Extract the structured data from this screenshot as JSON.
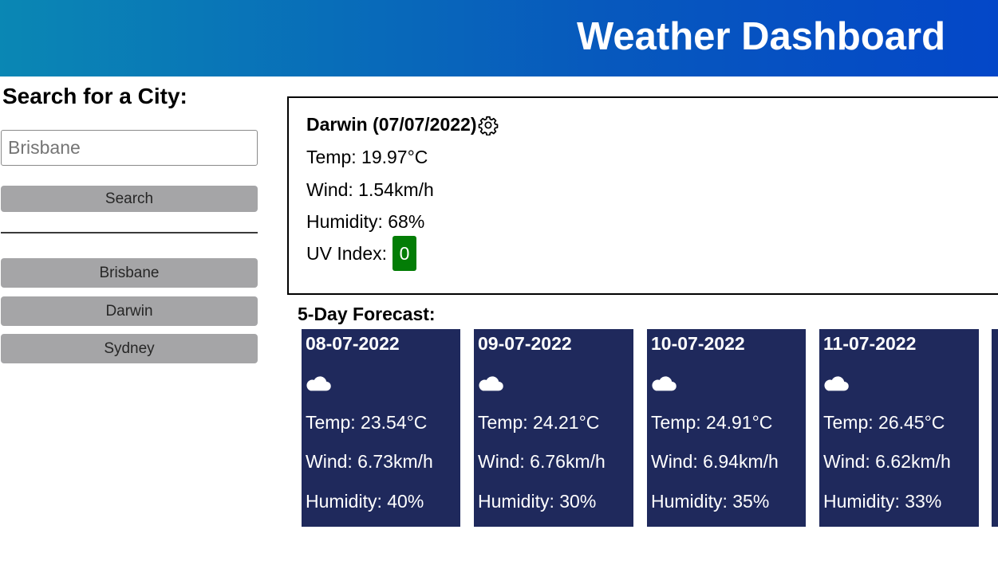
{
  "header": {
    "title": "Weather Dashboard"
  },
  "sidebar": {
    "heading": "Search for a City:",
    "search_placeholder": "Brisbane",
    "search_button": "Search",
    "history": [
      "Brisbane",
      "Darwin",
      "Sydney"
    ]
  },
  "current": {
    "title": "Darwin (07/07/2022)",
    "icon": "gear-icon",
    "temp": "Temp: 19.97°C",
    "wind": "Wind: 1.54km/h",
    "humidity": "Humidity: 68%",
    "uv_label": "UV Index:",
    "uv_value": "0",
    "uv_color": "#037d06"
  },
  "forecast": {
    "title": "5-Day Forecast:",
    "days": [
      {
        "date": "08-07-2022",
        "icon": "cloud-icon",
        "temp": "Temp: 23.54°C",
        "wind": "Wind: 6.73km/h",
        "humidity": "Humidity: 40%"
      },
      {
        "date": "09-07-2022",
        "icon": "cloud-icon",
        "temp": "Temp: 24.21°C",
        "wind": "Wind: 6.76km/h",
        "humidity": "Humidity: 30%"
      },
      {
        "date": "10-07-2022",
        "icon": "cloud-icon",
        "temp": "Temp: 24.91°C",
        "wind": "Wind: 6.94km/h",
        "humidity": "Humidity: 35%"
      },
      {
        "date": "11-07-2022",
        "icon": "cloud-icon",
        "temp": "Temp: 26.45°C",
        "wind": "Wind: 6.62km/h",
        "humidity": "Humidity: 33%"
      }
    ]
  },
  "colors": {
    "header_start": "#0a87b4",
    "header_end": "#0447c8",
    "card_bg": "#1f295c",
    "button_bg": "#a5a5a7"
  }
}
